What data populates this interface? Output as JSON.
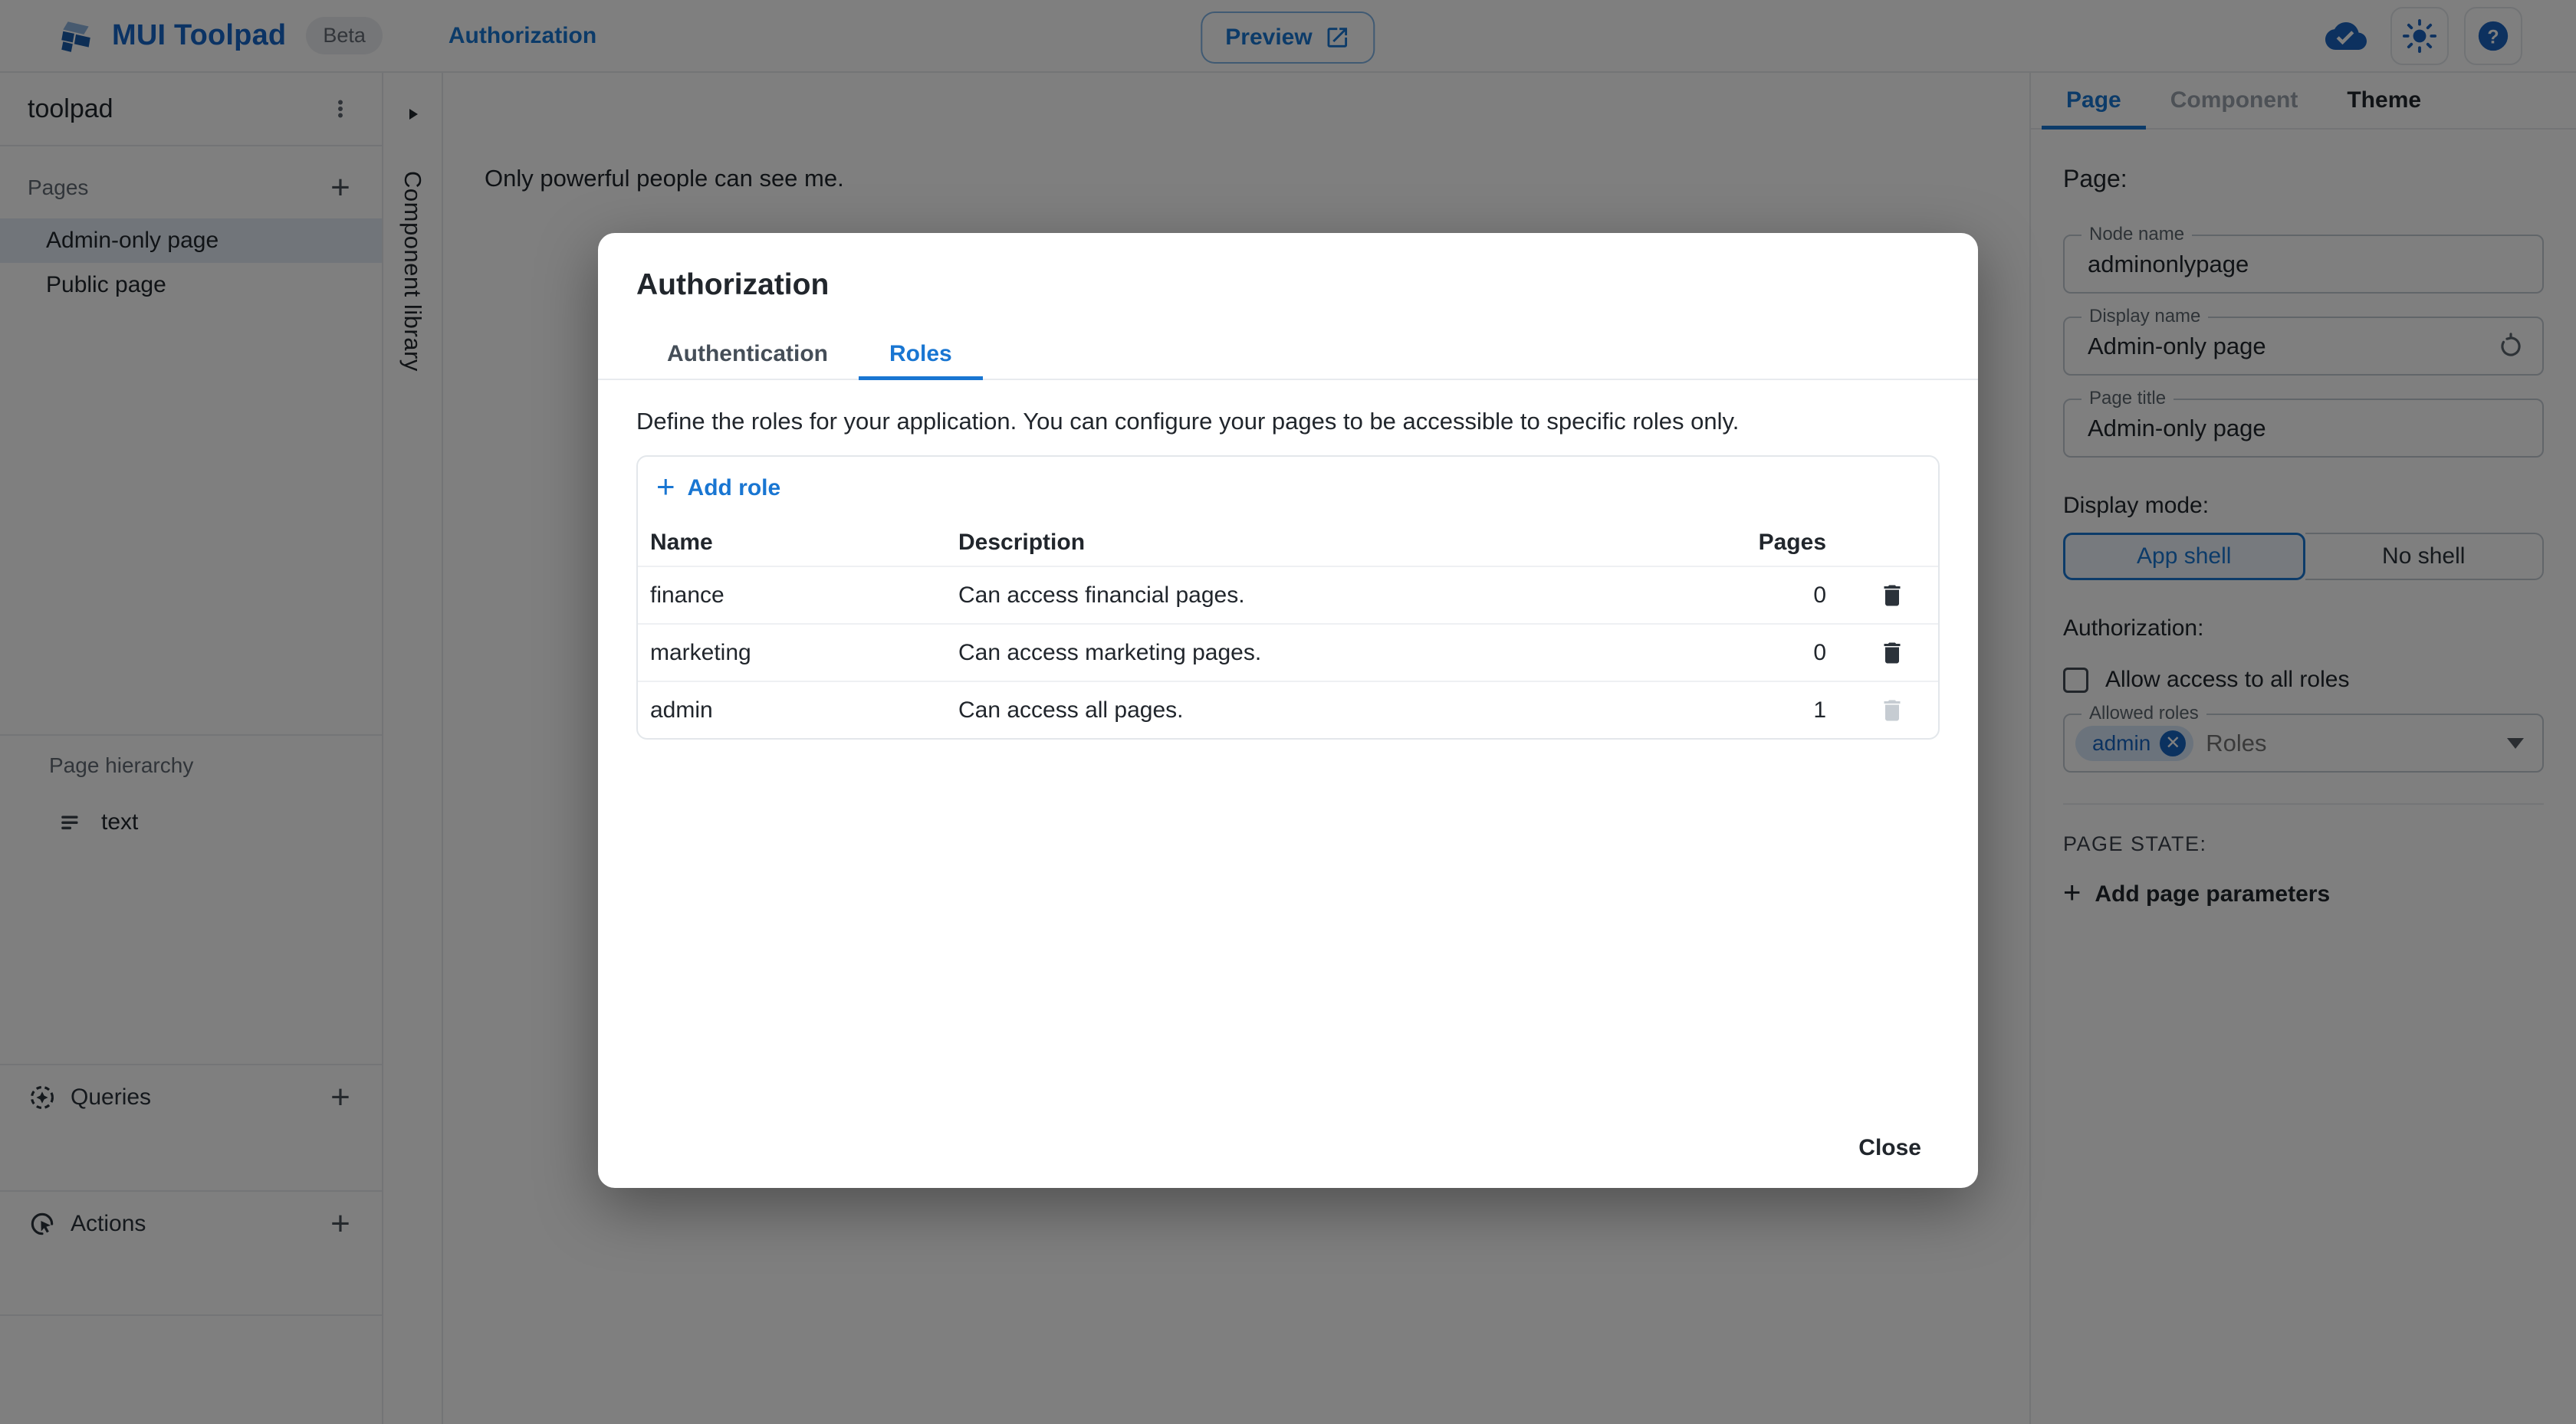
{
  "header": {
    "app_name": "MUI Toolpad",
    "beta_label": "Beta",
    "breadcrumb": "Authorization",
    "preview_label": "Preview",
    "icons": [
      "cloud-done-icon",
      "theme-brightness-icon",
      "help-icon"
    ]
  },
  "sidebar": {
    "project_name": "toolpad",
    "pages_label": "Pages",
    "pages": [
      {
        "label": "Admin-only page",
        "selected": true
      },
      {
        "label": "Public page",
        "selected": false
      }
    ],
    "hierarchy_label": "Page hierarchy",
    "hierarchy_items": [
      {
        "label": "text",
        "icon": "text-component-icon"
      }
    ],
    "queries_label": "Queries",
    "actions_label": "Actions"
  },
  "component_library": {
    "label": "Component library",
    "collapse_icon": "expand-right-icon"
  },
  "canvas": {
    "text": "Only powerful people can see me."
  },
  "dialog": {
    "title": "Authorization",
    "tabs": [
      {
        "label": "Authentication",
        "active": false
      },
      {
        "label": "Roles",
        "active": true
      }
    ],
    "description": "Define the roles for your application. You can configure your pages to be accessible to specific roles only.",
    "add_role_label": "Add role",
    "table": {
      "columns": [
        "Name",
        "Description",
        "Pages"
      ],
      "rows": [
        {
          "name": "finance",
          "description": "Can access financial pages.",
          "pages": 0,
          "deletable": true
        },
        {
          "name": "marketing",
          "description": "Can access marketing pages.",
          "pages": 0,
          "deletable": true
        },
        {
          "name": "admin",
          "description": "Can access all pages.",
          "pages": 1,
          "deletable": false
        }
      ]
    },
    "close_label": "Close"
  },
  "inspector": {
    "tabs": [
      {
        "label": "Page",
        "state": "active"
      },
      {
        "label": "Component",
        "state": "disabled"
      },
      {
        "label": "Theme",
        "state": "normal"
      }
    ],
    "heading": "Page:",
    "node_name": {
      "label": "Node name",
      "value": "adminonlypage"
    },
    "display_name": {
      "label": "Display name",
      "value": "Admin-only page",
      "reset_icon": "reset-icon"
    },
    "page_title": {
      "label": "Page title",
      "value": "Admin-only page"
    },
    "display_mode_label": "Display mode:",
    "display_modes": [
      {
        "label": "App shell",
        "selected": true
      },
      {
        "label": "No shell",
        "selected": false
      }
    ],
    "authorization_label": "Authorization:",
    "allow_all_label": "Allow access to all roles",
    "allow_all_checked": false,
    "allowed_roles": {
      "label": "Allowed roles",
      "chips": [
        "admin"
      ],
      "placeholder": "Roles"
    },
    "page_state_label": "PAGE STATE:",
    "add_params_label": "Add page parameters"
  },
  "colors": {
    "primary": "#1976d2",
    "brand_text": "#1667c9",
    "text_primary": "#21262c",
    "text_secondary": "#5d666f",
    "border": "#e6e9ec",
    "selected_item_bg": "#e3ebf5",
    "chip_bg": "#d7e6f8",
    "chip_text": "#1764c0",
    "disabled_icon": "#c6ccd2",
    "overlay": "rgba(0,0,0,0.5)"
  }
}
